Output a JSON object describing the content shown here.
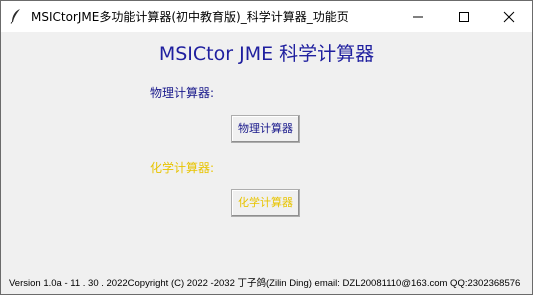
{
  "window": {
    "title": "MSICtorJME多功能计算器(初中教育版)_科学计算器_功能页"
  },
  "main": {
    "heading": "MSICtor JME 科学计算器",
    "physics_label": "物理计算器:",
    "physics_button": "物理计算器",
    "chemistry_label": "化学计算器:",
    "chemistry_button": "化学计算器"
  },
  "footer": {
    "text": "Version 1.0a - 11 . 30 . 2022Copyright (C) 2022 -2032  丁子鸽(Zilin Ding)  email: DZL20081110@163.com  QQ:2302368576"
  },
  "colors": {
    "heading": "#1f1f9f",
    "physics": "#1a1a8c",
    "chemistry": "#e8c400"
  }
}
